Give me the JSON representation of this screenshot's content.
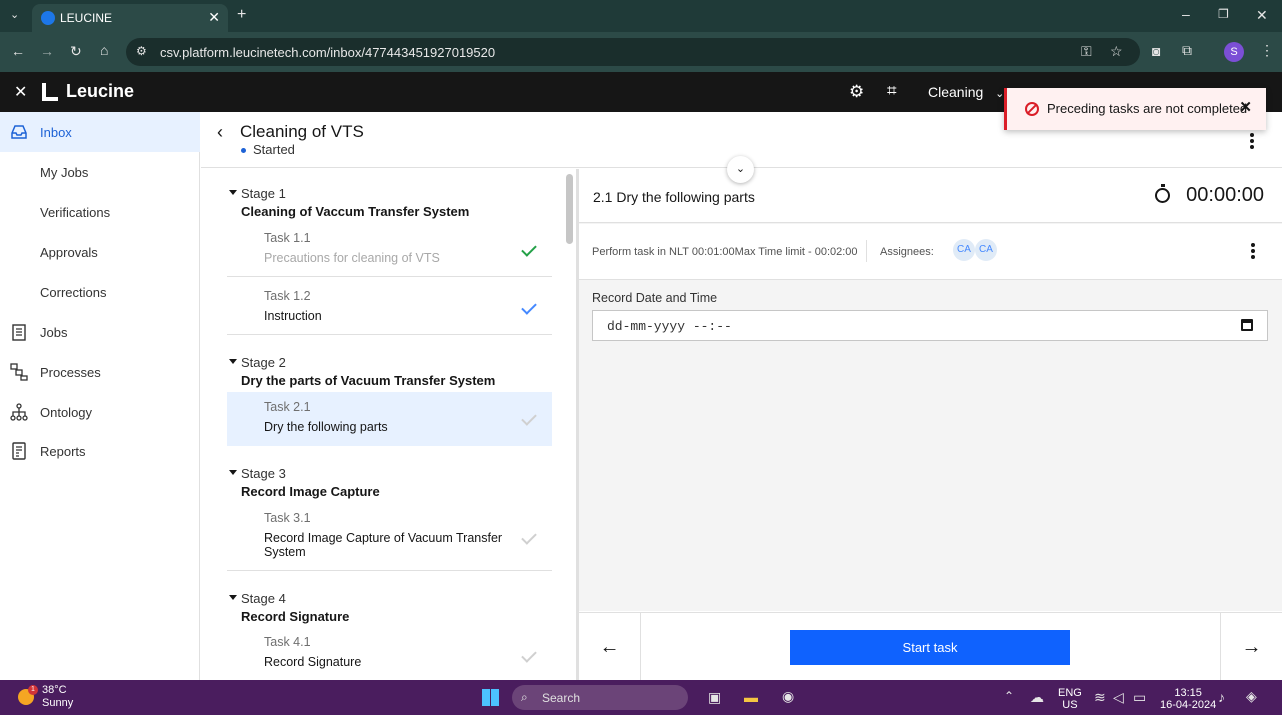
{
  "browser": {
    "tab_title": "LEUCINE",
    "url": "csv.platform.leucinetech.com/inbox/477443451927019520",
    "profile_initial": "S"
  },
  "app": {
    "brand": "Leucine",
    "facility_dropdown": "Cleaning",
    "toast_message": "Preceding tasks are not completed"
  },
  "sidebar": {
    "items": [
      {
        "label": "Inbox",
        "icon": "inbox-icon"
      },
      {
        "label": "My Jobs"
      },
      {
        "label": "Verifications"
      },
      {
        "label": "Approvals"
      },
      {
        "label": "Corrections"
      },
      {
        "label": "Jobs",
        "icon": "clipboard-icon"
      },
      {
        "label": "Processes",
        "icon": "flow-icon"
      },
      {
        "label": "Ontology",
        "icon": "hierarchy-icon"
      },
      {
        "label": "Reports",
        "icon": "report-icon"
      }
    ]
  },
  "job": {
    "title": "Cleaning of VTS",
    "status": "Started"
  },
  "stages": [
    {
      "number": "Stage 1",
      "name": "Cleaning of Vaccum Transfer System",
      "tasks": [
        {
          "number": "Task 1.1",
          "name": "Precautions for cleaning of VTS"
        },
        {
          "number": "Task 1.2",
          "name": "Instruction"
        }
      ]
    },
    {
      "number": "Stage 2",
      "name": "Dry the parts of Vacuum Transfer System",
      "tasks": [
        {
          "number": "Task 2.1",
          "name": "Dry the following parts"
        }
      ]
    },
    {
      "number": "Stage 3",
      "name": "Record Image Capture",
      "tasks": [
        {
          "number": "Task 3.1",
          "name": "Record Image Capture of Vacuum Transfer System"
        }
      ]
    },
    {
      "number": "Stage 4",
      "name": "Record Signature",
      "tasks": [
        {
          "number": "Task 4.1",
          "name": "Record Signature"
        }
      ]
    }
  ],
  "task_detail": {
    "title": "2.1 Dry the following parts",
    "timer": "00:00:00",
    "time_limit": "Perform task in NLT 00:01:00Max Time limit - 00:02:00",
    "assignees_label": "Assignees:",
    "assignees": [
      "CA",
      "CA"
    ],
    "field_label": "Record Date and Time",
    "field_placeholder": "dd-mm-yyyy --:--",
    "start_button": "Start task"
  },
  "taskbar": {
    "temperature": "38°C",
    "weather": "Sunny",
    "weather_badge": "1",
    "search_placeholder": "Search",
    "language": "ENG",
    "region": "US",
    "time": "13:15",
    "date": "16-04-2024"
  },
  "colors": {
    "primary": "#0f62fe",
    "active_nav_bg": "#e7f1ff",
    "error": "#da1e28",
    "check_green": "#24a148",
    "check_blue": "#4589ff",
    "taskbar": "#4a1d5e"
  }
}
